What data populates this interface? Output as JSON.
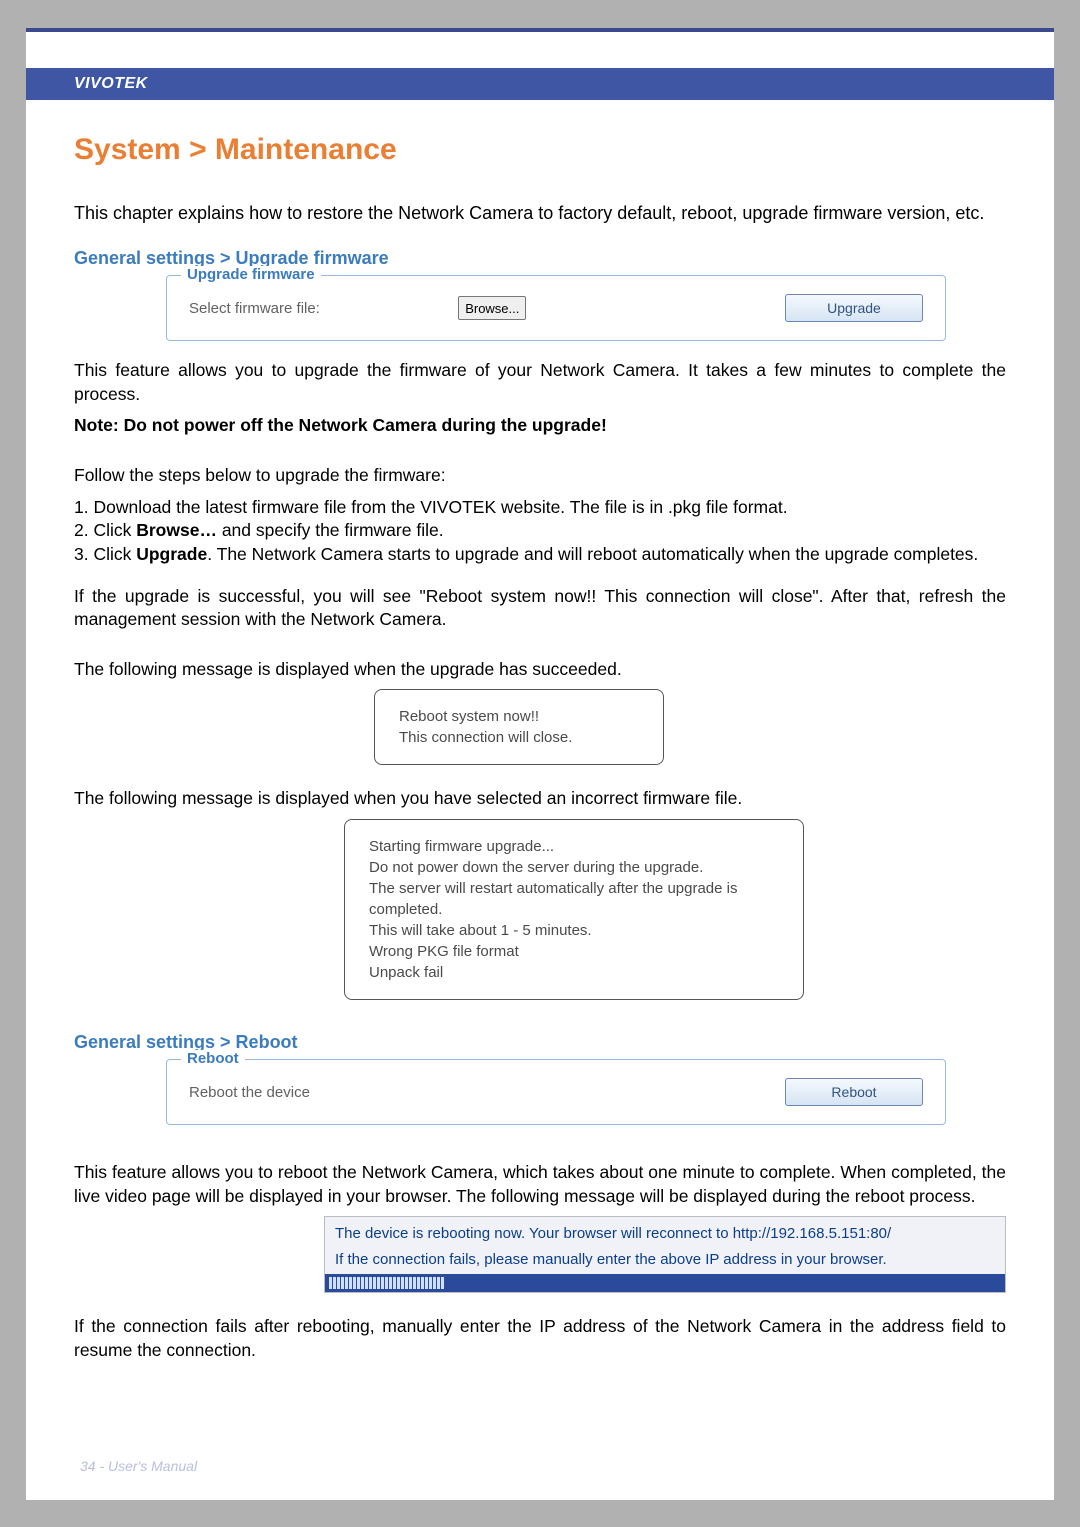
{
  "brand_header": "VIVOTEK",
  "page_title": "System > Maintenance",
  "intro_text": "This chapter explains how to restore the Network Camera to factory default, reboot, upgrade firmware version, etc.",
  "section1": {
    "heading": "General settings > Upgrade firmware",
    "legend": "Upgrade firmware",
    "label_select": "Select firmware file:",
    "browse_label": "Browse...",
    "upgrade_button": "Upgrade",
    "desc_p1": "This feature allows you to upgrade the firmware of your Network Camera. It takes a few minutes to complete the process.",
    "note_bold": "Note: Do not power off the Network Camera during the upgrade!",
    "follow_line": "Follow the steps below to upgrade the firmware:",
    "step1_pre": "1. Download the latest firmware file from the VIVOTEK website. The file is in .pkg file format.",
    "step2_pre": "2. Click ",
    "step2_bold": "Browse…",
    "step2_post": " and specify the firmware file.",
    "step3_pre": "3. Click ",
    "step3_bold": "Upgrade",
    "step3_post": ". The Network Camera starts to upgrade and will reboot automatically when the upgrade completes.",
    "success_p": "If the upgrade is successful, you will see \"Reboot system now!! This connection will close\". After that, refresh the management session with the Network Camera.",
    "msg_succeed_intro": "The following message is displayed when the upgrade has succeeded.",
    "msg_succeed_line1": "Reboot system now!!",
    "msg_succeed_line2": "This connection will close.",
    "msg_fail_intro": "The following message is displayed when you have selected an incorrect firmware file.",
    "msg_fail_l1": "Starting firmware upgrade...",
    "msg_fail_l2": "Do not power down the server during the upgrade.",
    "msg_fail_l3": "The server will restart automatically after the upgrade is completed.",
    "msg_fail_l4": "This will take about 1 - 5 minutes.",
    "msg_fail_l5": "Wrong PKG file format",
    "msg_fail_l6": "Unpack fail"
  },
  "section2": {
    "heading": "General settings > Reboot",
    "legend": "Reboot",
    "label_reboot": "Reboot the device",
    "reboot_button": "Reboot",
    "desc_p1": "This feature allows you to reboot the Network Camera, which takes about one minute to complete. When completed, the live video page will be displayed in your browser. The following message will be displayed during the reboot process.",
    "msg_line1": "The device is rebooting now. Your browser will reconnect to http://192.168.5.151:80/",
    "msg_line2": "If the connection fails, please manually enter the above IP address in your browser.",
    "desc_p2": "If the connection fails after rebooting, manually enter the IP address of the Network Camera in the address field to resume the connection."
  },
  "footer": "34 - User's Manual"
}
